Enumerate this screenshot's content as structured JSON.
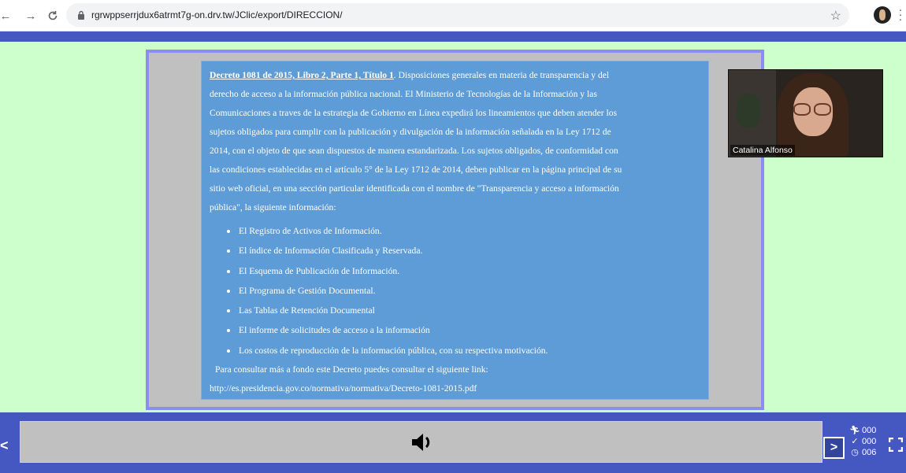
{
  "browser": {
    "url": "rgrwppserrjdux6atrmt7g-on.drv.tw/JClic/export/DIRECCION/",
    "icons": [
      "back-icon",
      "forward-icon",
      "reload-icon",
      "lock-icon",
      "star-icon",
      "profile-avatar",
      "menu-dots-icon"
    ]
  },
  "panel": {
    "title_ref": "Decreto 1081 de 2015, Libro 2, Parte 1, Título 1",
    "intro_lines": [
      ". Disposiciones generales en materia de transparencia y del",
      "derecho de acceso a la información pública nacional. El Ministerio de Tecnologías de la Información y las",
      "Comunicaciones a traves de la estrategia de Gobierno en Línea expedirá los lineamientos que deben atender los",
      "sujetos obligados para cumplir con la publicación y divulgación de la información señalada en la Ley 1712 de",
      "2014, con el objeto de que sean dispuestos de manera estandarizada. Los sujetos obligados, de conformidad con",
      "las condiciones establecidas en el artículo 5° de la Ley 1712 de 2014, deben publicar en la página principal de su",
      "sitio web oficial, en una sección particular identificada con el nombre de \"Transparencia y acceso a información",
      "pública\", la siguiente información:"
    ],
    "bullets": [
      "El Registro de Activos de Información.",
      "El índice de Información Clasificada y Reservada.",
      "El Esquema de Publicación de Información.",
      "El Programa de Gestión Documental.",
      "Las Tablas de Retención Documental",
      "El informe de solicitudes de acceso a la información",
      "Los costos de reproducción de la información pública, con su respectiva motivación."
    ],
    "consult": "Para consultar más a fondo este Decreto puedes consultar el siguiente link:",
    "link": "http://es.presidencia.gov.co/normativa/normativa/Decreto-1081-2015.pdf"
  },
  "video": {
    "participant_name": "Catalina Alfonso"
  },
  "controls": {
    "prev_label": "<",
    "next_label": ">",
    "counters": {
      "actions": "000",
      "correct": "000",
      "time": "006"
    }
  },
  "colors": {
    "background": "#ccffcc",
    "bar": "#4557c0",
    "panel": "#5d9cd6",
    "frame_border": "#8b8df0",
    "message_box": "#c0c0c0"
  }
}
